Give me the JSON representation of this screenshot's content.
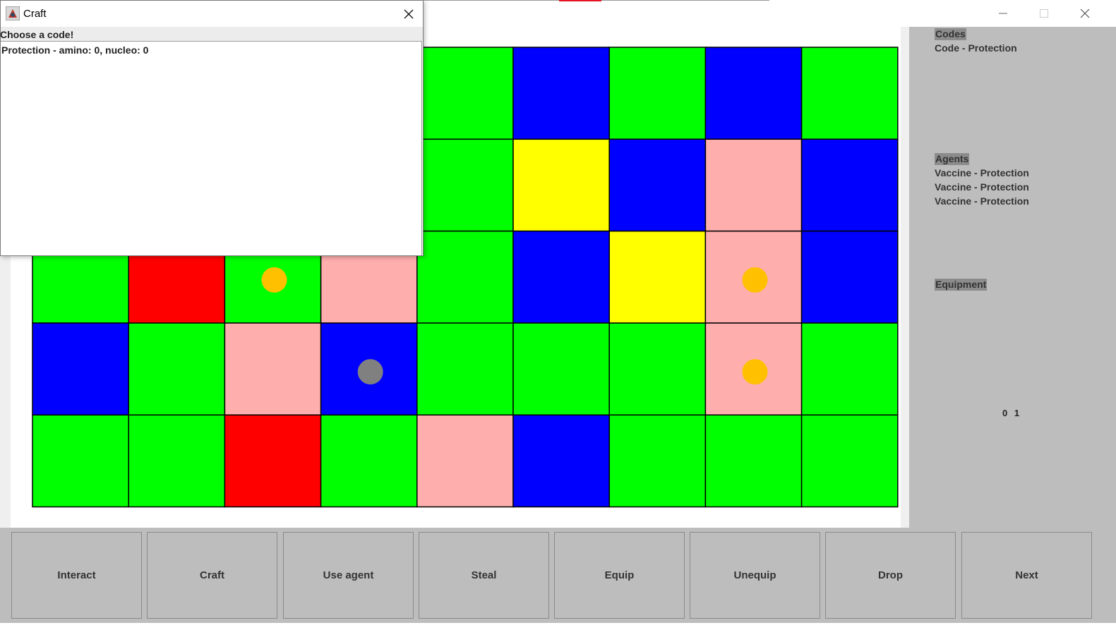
{
  "window": {
    "minimize_icon": "minimize-icon",
    "maximize_icon": "maximize-icon",
    "close_icon": "close-icon"
  },
  "grid": {
    "rows": 5,
    "cols": 9,
    "colors": {
      "G": "#00ff00",
      "B": "#0000ff",
      "Y": "#ffff00",
      "P": "#ffaeae",
      "R": "#ff0000"
    },
    "cells": [
      [
        "G",
        "G",
        "G",
        "G",
        "G",
        "B",
        "G",
        "B",
        "G"
      ],
      [
        "G",
        "G",
        "G",
        "G",
        "G",
        "Y",
        "B",
        "P",
        "B"
      ],
      [
        "G",
        "R",
        "G",
        "P",
        "G",
        "B",
        "Y",
        "P",
        "B"
      ],
      [
        "B",
        "G",
        "P",
        "B",
        "G",
        "G",
        "G",
        "P",
        "G"
      ],
      [
        "G",
        "G",
        "R",
        "G",
        "P",
        "B",
        "G",
        "G",
        "G"
      ]
    ],
    "tokens": [
      {
        "row": 2,
        "col": 2,
        "color": "#ffc000"
      },
      {
        "row": 2,
        "col": 7,
        "color": "#ffc000"
      },
      {
        "row": 3,
        "col": 3,
        "color": "#808080"
      },
      {
        "row": 3,
        "col": 7,
        "color": "#ffc000"
      }
    ]
  },
  "side_panel": {
    "codes_heading": "Codes",
    "codes": [
      "Code - Protection"
    ],
    "agents_heading": "Agents",
    "agents": [
      "Vaccine - Protection",
      "Vaccine - Protection",
      "Vaccine - Protection"
    ],
    "equipment_heading": "Equipment",
    "counter": "0 1"
  },
  "buttons": [
    "Interact",
    "Craft",
    "Use agent",
    "Steal",
    "Equip",
    "Unequip",
    "Drop",
    "Next"
  ],
  "dialog": {
    "title": "Craft",
    "icon": "java-app-icon",
    "close_icon": "close-icon",
    "header": "Choose a code!",
    "items": [
      "Protection - amino: 0, nucleo: 0"
    ]
  }
}
